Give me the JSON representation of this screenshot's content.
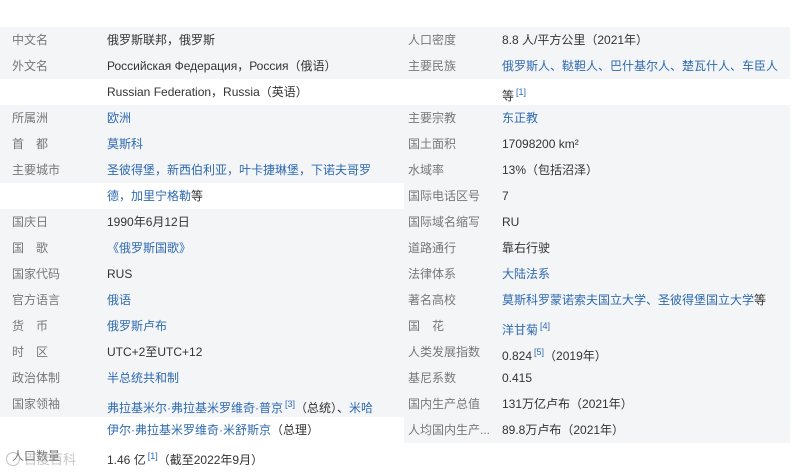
{
  "rows": [
    {
      "l_label": "中文名",
      "l_value": "俄罗斯联邦，俄罗斯",
      "r_label": "人口密度",
      "r_value": "8.8 人/平方公里（2021年）"
    },
    {
      "l_label": "外文名",
      "l_value": "Российская Федерация，Россия（俄语）",
      "r_label": "主要民族",
      "r_value": "俄罗斯人、鞑靼人、巴什基尔人、楚瓦什人、车臣人"
    },
    {
      "l_value": "Russian Federation，Russia（英语）",
      "r_value": "等",
      "r_sup": "[1]"
    },
    {
      "l_label": "所属洲",
      "l_value": "欧洲",
      "r_label": "主要宗教",
      "r_value": "东正教"
    },
    {
      "l_label": "首　都",
      "l_value": "莫斯科",
      "r_label": "国土面积",
      "r_value": "17098200 km²"
    },
    {
      "l_label": "主要城市",
      "l_value": "圣彼得堡，新西伯利亚，叶卡捷琳堡，下诺夫哥罗",
      "r_label": "水域率",
      "r_value": "13%（包括沼泽）"
    },
    {
      "l_value_link": "德，加里宁格勒",
      "l_value_tail": "等",
      "r_label": "国际电话区号",
      "r_value": "7"
    },
    {
      "l_label": "国庆日",
      "l_value": "1990年6月12日",
      "r_label": "国际域名缩写",
      "r_value": "RU"
    },
    {
      "l_label": "国　歌",
      "l_value": "《俄罗斯国歌》",
      "r_label": "道路通行",
      "r_value": "靠右行驶"
    },
    {
      "l_label": "国家代码",
      "l_value": "RUS",
      "r_label": "法律体系",
      "r_value": "大陆法系"
    },
    {
      "l_label": "官方语言",
      "l_value": "俄语",
      "r_label": "著名高校",
      "r_value_link": "莫斯科罗蒙诺索夫国立大学、圣彼得堡国立大学",
      "r_value_tail": "等"
    },
    {
      "l_label": "货　币",
      "l_value": "俄罗斯卢布",
      "r_label": "国　花",
      "r_value": "洋甘菊",
      "r_sup": "[4]"
    },
    {
      "l_label": "时　区",
      "l_value": "UTC+2至UTC+12",
      "r_label": "人类发展指数",
      "r_value": "0.824",
      "r_sup": "[5]",
      "r_tail": "（2019年）"
    },
    {
      "l_label": "政治体制",
      "l_value": "半总统共和制",
      "r_label": "基尼系数",
      "r_value": "0.415"
    },
    {
      "l_label": "国家领袖",
      "l_value_link": "弗拉基米尔·弗拉基米罗维奇·普京",
      "l_sup": "[3]",
      "l_tail": "（总统）、",
      "l_tail_link": "米哈",
      "r_label": "国内生产总值",
      "r_value": "131万亿卢布（2021年）"
    },
    {
      "l_value_link": "伊尔·弗拉基米罗维奇·米舒斯京",
      "l_tail": "（总理）",
      "r_label": "人均国内生产...",
      "r_value": "89.8万卢布（2021年）"
    },
    {
      "l_label": "人口数量",
      "l_value": "1.46 亿",
      "l_sup": "[1]",
      "l_tail": "（截至2022年9月）"
    }
  ],
  "watermark": "百度百科"
}
